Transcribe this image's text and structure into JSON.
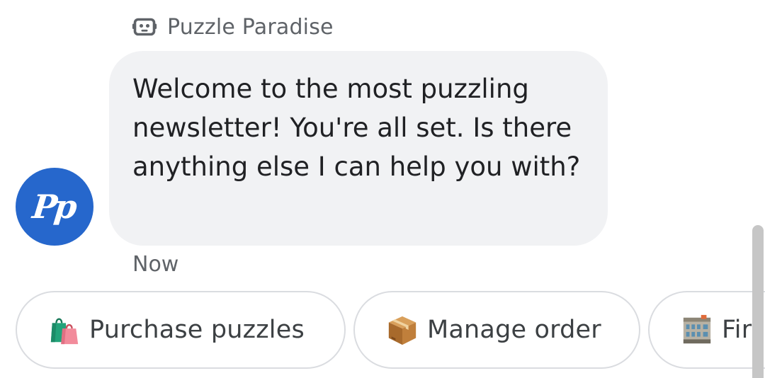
{
  "sender": {
    "icon": "robot-icon",
    "name": "Puzzle Paradise"
  },
  "avatar": {
    "initials": "Pp",
    "color": "#2667cc"
  },
  "message": {
    "text": "Welcome to the most puzzling newsletter! You're all set. Is there anything else I can help you with?",
    "timestamp": "Now"
  },
  "suggestions": [
    {
      "icon": "shopping-bags-icon",
      "label": "Purchase puzzles"
    },
    {
      "icon": "package-icon",
      "label": "Manage order"
    },
    {
      "icon": "department-store-icon",
      "label": "Fir"
    }
  ]
}
